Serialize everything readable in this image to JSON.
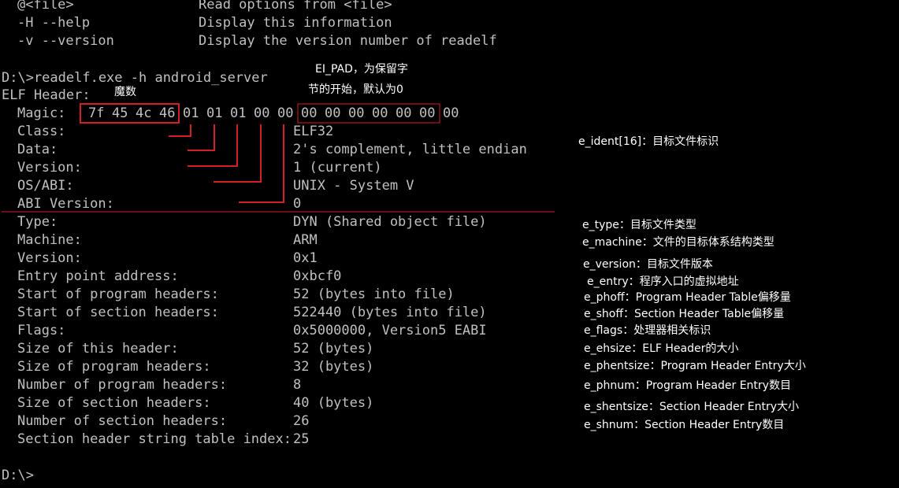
{
  "help": {
    "lines": [
      {
        "opt": "@<file>",
        "desc": "Read options from <file>"
      },
      {
        "opt": "-H --help",
        "desc": "Display this information"
      },
      {
        "opt": "-v --version",
        "desc": "Display the version number of readelf"
      }
    ]
  },
  "prompt1": "D:\\>readelf.exe -h android_server",
  "elf_header_title": "ELF Header:",
  "magic": {
    "label": "Magic:",
    "bytes": [
      "7f",
      "45",
      "4c",
      "46",
      "01",
      "01",
      "01",
      "00",
      "00",
      "00",
      "00",
      "00",
      "00",
      "00",
      "00",
      "00"
    ]
  },
  "ident_fields": [
    {
      "label": "Class:",
      "value": "ELF32"
    },
    {
      "label": "Data:",
      "value": "2's complement, little endian"
    },
    {
      "label": "Version:",
      "value": "1 (current)"
    },
    {
      "label": "OS/ABI:",
      "value": "UNIX - System V"
    },
    {
      "label": "ABI Version:",
      "value": "0"
    }
  ],
  "header_fields": [
    {
      "label": "Type:",
      "value": "DYN (Shared object file)"
    },
    {
      "label": "Machine:",
      "value": "ARM"
    },
    {
      "label": "Version:",
      "value": "0x1"
    },
    {
      "label": "Entry point address:",
      "value": "0xbcf0"
    },
    {
      "label": "Start of program headers:",
      "value": "52 (bytes into file)"
    },
    {
      "label": "Start of section headers:",
      "value": "522440 (bytes into file)"
    },
    {
      "label": "Flags:",
      "value": "0x5000000, Version5 EABI"
    },
    {
      "label": "Size of this header:",
      "value": "52 (bytes)"
    },
    {
      "label": "Size of program headers:",
      "value": "32 (bytes)"
    },
    {
      "label": "Number of program headers:",
      "value": "8"
    },
    {
      "label": "Size of section headers:",
      "value": "40 (bytes)"
    },
    {
      "label": "Number of section headers:",
      "value": "26"
    },
    {
      "label": "Section header string table index:",
      "value": "25"
    }
  ],
  "prompt2": "D:\\>",
  "annotations": {
    "ei_pad_1": "EI_PAD，为保留字",
    "ei_pad_2": "节的开始，默认为0",
    "magic_label": "魔数",
    "e_ident": "e_ident[16]：目标文件标识",
    "fields": [
      "e_type：目标文件类型",
      "e_machine：文件的目标体系结构类型",
      "e_version：目标文件版本",
      "e_entry：程序入口的虚拟地址",
      "e_phoff：Program Header Table偏移量",
      "e_shoff：Section Header Table偏移量",
      "e_flags：处理器相关标识",
      "e_ehsize：ELF Header的大小",
      "e_phentsize：Program Header Entry大小",
      "e_phnum：Program Header Entry数目",
      "e_shentsize：Section Header Entry大小",
      "e_shnum：Section Header Entry数目"
    ]
  },
  "colors": {
    "background": "#000000",
    "text": "#c0c0c0",
    "annotation": "#ffffff",
    "highlight": "#d32026"
  }
}
